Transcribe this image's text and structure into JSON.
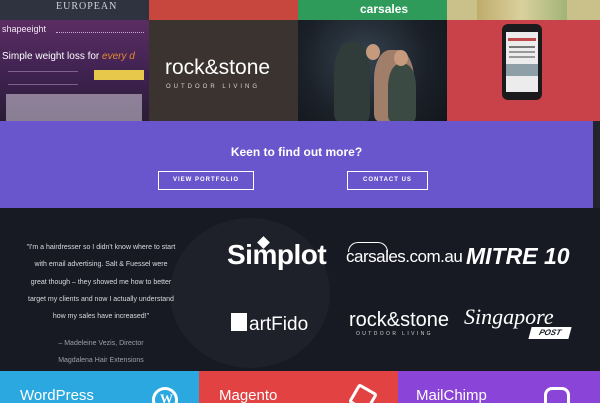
{
  "portfolio": {
    "top_row": {
      "european_label": "EUROPEAN",
      "carsales_label": "carsales"
    },
    "shapeeight": {
      "logo": "shapeeight",
      "headline_main": "Simple weight loss for ",
      "headline_accent": "every d"
    },
    "rockstone": {
      "name": "rock&stone",
      "tagline": "OUTDOOR LIVING"
    }
  },
  "cta": {
    "heading": "Keen to find out more?",
    "portfolio_button": "VIEW PORTFOLIO",
    "contact_button": "CONTACT US"
  },
  "testimonial": {
    "quote": "\"I'm a hairdresser so I didn't know where to start with email advertising. Salt & Fuessel were great though – they showed me how to better target my clients and now I actually understand how my sales have increased!\"",
    "author": "– Madeleine Vezis, Director",
    "company": "Magdalena Hair Extensions"
  },
  "clients": {
    "simplot": "Simplot",
    "carsales": "carsales.com.au",
    "mitre": "MITRE 10",
    "artfido": "artFido",
    "rockstone": "rock&stone",
    "rockstone_sub": "OUTDOOR LIVING",
    "singapore": "Singapore",
    "singapore_post": "POST"
  },
  "services": [
    {
      "label": "WordPress",
      "icon": "wordpress-icon",
      "color": "#2aa8df"
    },
    {
      "label": "Magento",
      "icon": "magento-icon",
      "color": "#e24242"
    },
    {
      "label": "MailChimp",
      "icon": "mailchimp-icon",
      "color": "#8a44d8"
    }
  ],
  "colors": {
    "cta_purple": "#6a56cc",
    "dark_bg": "#181a23"
  }
}
